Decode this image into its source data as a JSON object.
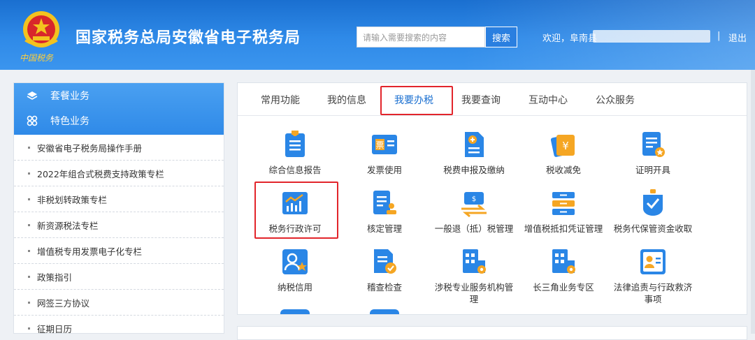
{
  "header": {
    "emblem_caption": "中国税务",
    "title": "国家税务总局安徽省电子税务局",
    "search_placeholder": "请输入需要搜索的内容",
    "search_button": "搜索",
    "welcome": "欢迎，阜南县",
    "separator": "|",
    "logout": "退出"
  },
  "sidebar": {
    "head": [
      {
        "label": "套餐业务",
        "icon": "layers-icon"
      },
      {
        "label": "特色业务",
        "icon": "grid-icon"
      }
    ],
    "items": [
      "安徽省电子税务局操作手册",
      "2022年组合式税费支持政策专栏",
      "非税划转政策专栏",
      "新资源税法专栏",
      "增值税专用发票电子化专栏",
      "政策指引",
      "网签三方协议",
      "征期日历"
    ]
  },
  "tabs": {
    "items": [
      "常用功能",
      "我的信息",
      "我要办税",
      "我要查询",
      "互动中心",
      "公众服务"
    ],
    "active": "我要办税"
  },
  "tiles": [
    {
      "label": "综合信息报告",
      "icon": "document-report-icon"
    },
    {
      "label": "发票使用",
      "icon": "invoice-icon"
    },
    {
      "label": "税费申报及缴纳",
      "icon": "declare-pay-icon"
    },
    {
      "label": "税收减免",
      "icon": "tax-relief-icon"
    },
    {
      "label": "证明开具",
      "icon": "certificate-icon"
    },
    {
      "label": "税务行政许可",
      "icon": "admin-permit-chart-icon"
    },
    {
      "label": "核定管理",
      "icon": "approval-management-icon"
    },
    {
      "label": "一般退（抵）税管理",
      "icon": "tax-refund-icon"
    },
    {
      "label": "增值税抵扣凭证管理",
      "icon": "vat-deduction-icon"
    },
    {
      "label": "税务代保管资金收取",
      "icon": "custody-fund-icon"
    },
    {
      "label": "纳税信用",
      "icon": "tax-credit-icon"
    },
    {
      "label": "稽查检查",
      "icon": "inspection-icon"
    },
    {
      "label": "涉税专业服务机构管理",
      "icon": "service-agency-icon"
    },
    {
      "label": "长三角业务专区",
      "icon": "yangtze-delta-icon"
    },
    {
      "label": "法律追责与行政救济事项",
      "icon": "legal-relief-icon"
    }
  ],
  "colors": {
    "accent": "#1a6fd0",
    "highlight_red": "#e2252b",
    "icon_blue": "#2a86e6",
    "icon_orange": "#f5a623"
  }
}
